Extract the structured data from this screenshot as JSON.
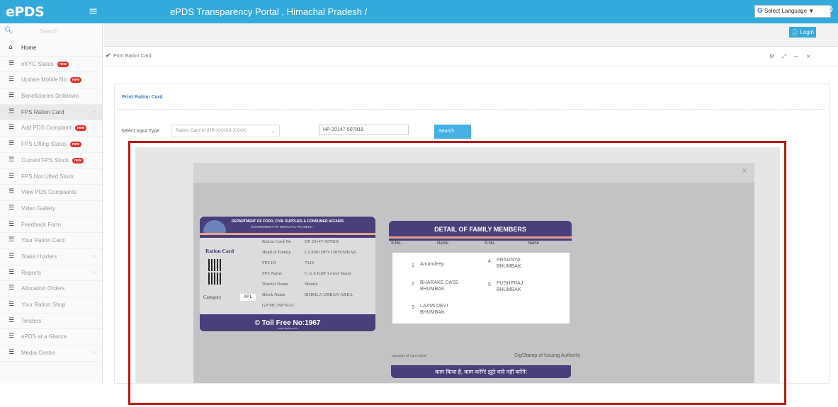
{
  "header": {
    "logo": "ePDS",
    "menu_icon": "hamburger-icon",
    "portal_title": "ePDS Transparency Portal , Himachal Pradesh /",
    "language_select": "Select Language",
    "language_caret": "▼",
    "settings_icon": "gear-icon"
  },
  "sidebar": {
    "search_placeholder": "Search",
    "items": [
      {
        "label": "Home",
        "badge": "",
        "arrow": ""
      },
      {
        "label": "eKYC Status",
        "badge": "new",
        "arrow": ""
      },
      {
        "label": "Update Mobile No",
        "badge": "new",
        "arrow": ""
      },
      {
        "label": "Beneficiaries Drilldown",
        "badge": "",
        "arrow": ""
      },
      {
        "label": "FPS Ration Card",
        "badge": "",
        "arrow": "›"
      },
      {
        "label": "Add PDS Complaint",
        "badge": "new",
        "arrow": ""
      },
      {
        "label": "FPS Lifting Status",
        "badge": "new",
        "arrow": ""
      },
      {
        "label": "Current FPS Stock",
        "badge": "new",
        "arrow": ""
      },
      {
        "label": "FPS Not Lifted Stock",
        "badge": "",
        "arrow": ""
      },
      {
        "label": "View PDS Complaints",
        "badge": "",
        "arrow": ""
      },
      {
        "label": "Video Gallery",
        "badge": "",
        "arrow": ""
      },
      {
        "label": "Feedback Form",
        "badge": "",
        "arrow": ""
      },
      {
        "label": "Your Ration Card",
        "badge": "",
        "arrow": ""
      },
      {
        "label": "Stake Holders",
        "badge": "",
        "arrow": "›"
      },
      {
        "label": "Reports",
        "badge": "",
        "arrow": "›"
      },
      {
        "label": "Allocation Orders",
        "badge": "",
        "arrow": ""
      },
      {
        "label": "Your Ration Shop",
        "badge": "",
        "arrow": ""
      },
      {
        "label": "Tenders",
        "badge": "",
        "arrow": ""
      },
      {
        "label": "ePDS at a Glance",
        "badge": "",
        "arrow": ""
      },
      {
        "label": "Media Centre",
        "badge": "",
        "arrow": "›"
      }
    ]
  },
  "main": {
    "login_label": "Login",
    "panel_title": "Print Ration Card",
    "panel_tools": "⚙ ⤢ − ×",
    "section_title": "Print Ration Card",
    "input_type_label": "Select Input Type",
    "input_type_value": "Ration Card Id (HP-XXXXX-XXXX)",
    "input_type_caret": "⌄",
    "card_number_value": "HP-20147-507818",
    "search_button": "Search"
  },
  "modal": {
    "close": "×",
    "card": {
      "department": "DEPARTMENT OF FOOD, CIVIL SUPPLIES & CONSUMER AFFAIRS",
      "government": "GOVERNMENT OF HIMACHAL PRADESH",
      "title": "Ration Card",
      "category_label": "Category",
      "category_value": "APL",
      "fields": [
        {
          "k": "Ration Card No",
          "v": "HP 20147-507818"
        },
        {
          "k": "Head of Family",
          "v": "LAXMI DEVI BHUMBAK"
        },
        {
          "k": "FPS ID",
          "v": "7324"
        },
        {
          "k": "FPS Name",
          "v": "C.A.S KDF Lower Bazar"
        },
        {
          "k": "District Name",
          "v": "Shimla"
        },
        {
          "k": "Block Name",
          "v": "SHIMLA URBAN AREA"
        },
        {
          "k": "GP/MC/NP/NAC",
          "v": ""
        }
      ],
      "toll_free": "© Toll Free No:1967",
      "website": "www.epds.co.in"
    },
    "family": {
      "title": "DETAIL OF FAMILY MEMBERS",
      "headers": [
        "S.No.",
        "Name",
        "S.No.",
        "Name"
      ],
      "members": [
        {
          "sno": "1",
          "name": "Amandeep"
        },
        {
          "sno": "2",
          "name": "BHARAKE DASS BHUMBAK"
        },
        {
          "sno": "3",
          "name": "LAXMI DEVI BHUMBAK"
        },
        {
          "sno": "4",
          "name": "PRAGNYA BHUMBAK"
        },
        {
          "sno": "5",
          "name": "PUSHPRAJ BHUMBAK"
        }
      ],
      "signature_holder": "Signature of Card Holder",
      "signature_authority": "Sig/Stamp of Issuing Authority",
      "hindi_slogan": "काम किया है, काम करेंगे! झूठे वादे नहीं करेंगे!"
    }
  },
  "highlight_color": "#b81818",
  "accent_color": "#33aadc"
}
